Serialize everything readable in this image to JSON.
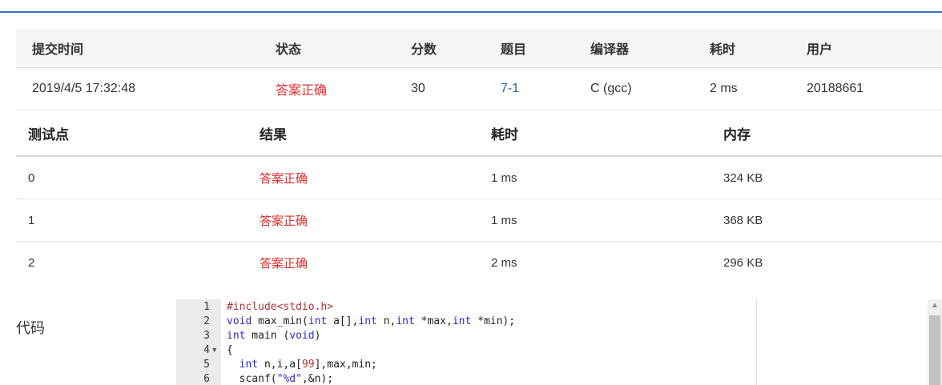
{
  "submission": {
    "headers": [
      "提交时间",
      "状态",
      "分数",
      "题目",
      "编译器",
      "耗时",
      "用户"
    ],
    "row": {
      "time": "2019/4/5 17:32:48",
      "status": "答案正确",
      "score": "30",
      "problem": "7-1",
      "compiler": "C (gcc)",
      "duration": "2 ms",
      "user": "20188661"
    }
  },
  "cases": {
    "headers": [
      "测试点",
      "结果",
      "耗时",
      "内存"
    ],
    "rows": [
      {
        "id": "0",
        "result": "答案正确",
        "time": "1 ms",
        "memory": "324 KB"
      },
      {
        "id": "1",
        "result": "答案正确",
        "time": "1 ms",
        "memory": "368 KB"
      },
      {
        "id": "2",
        "result": "答案正确",
        "time": "2 ms",
        "memory": "296 KB"
      }
    ]
  },
  "code": {
    "label": "代码",
    "line_numbers": [
      "1",
      "2",
      "3",
      "4",
      "5",
      "6"
    ],
    "fold_marker": "▼",
    "tokens": {
      "l1_pp": "#include<stdio.h>",
      "void": "void",
      "int": "int",
      "l2_a": " max_min(",
      "l2_b": " a[],",
      "l2_c": " n,",
      "l2_d": " *max,",
      "l2_e": " *min);",
      "l3_a": " main (",
      "l3_b": ")",
      "l4": "{",
      "l5_a": "  ",
      "l5_b": " n,i,a[",
      "l5_num": "99",
      "l5_c": "],max,min;",
      "l6_a": "  scanf(",
      "l6_str": "\"%d\"",
      "l6_b": ",&n);"
    }
  },
  "scrollbar": {
    "up_icon": "▲"
  }
}
